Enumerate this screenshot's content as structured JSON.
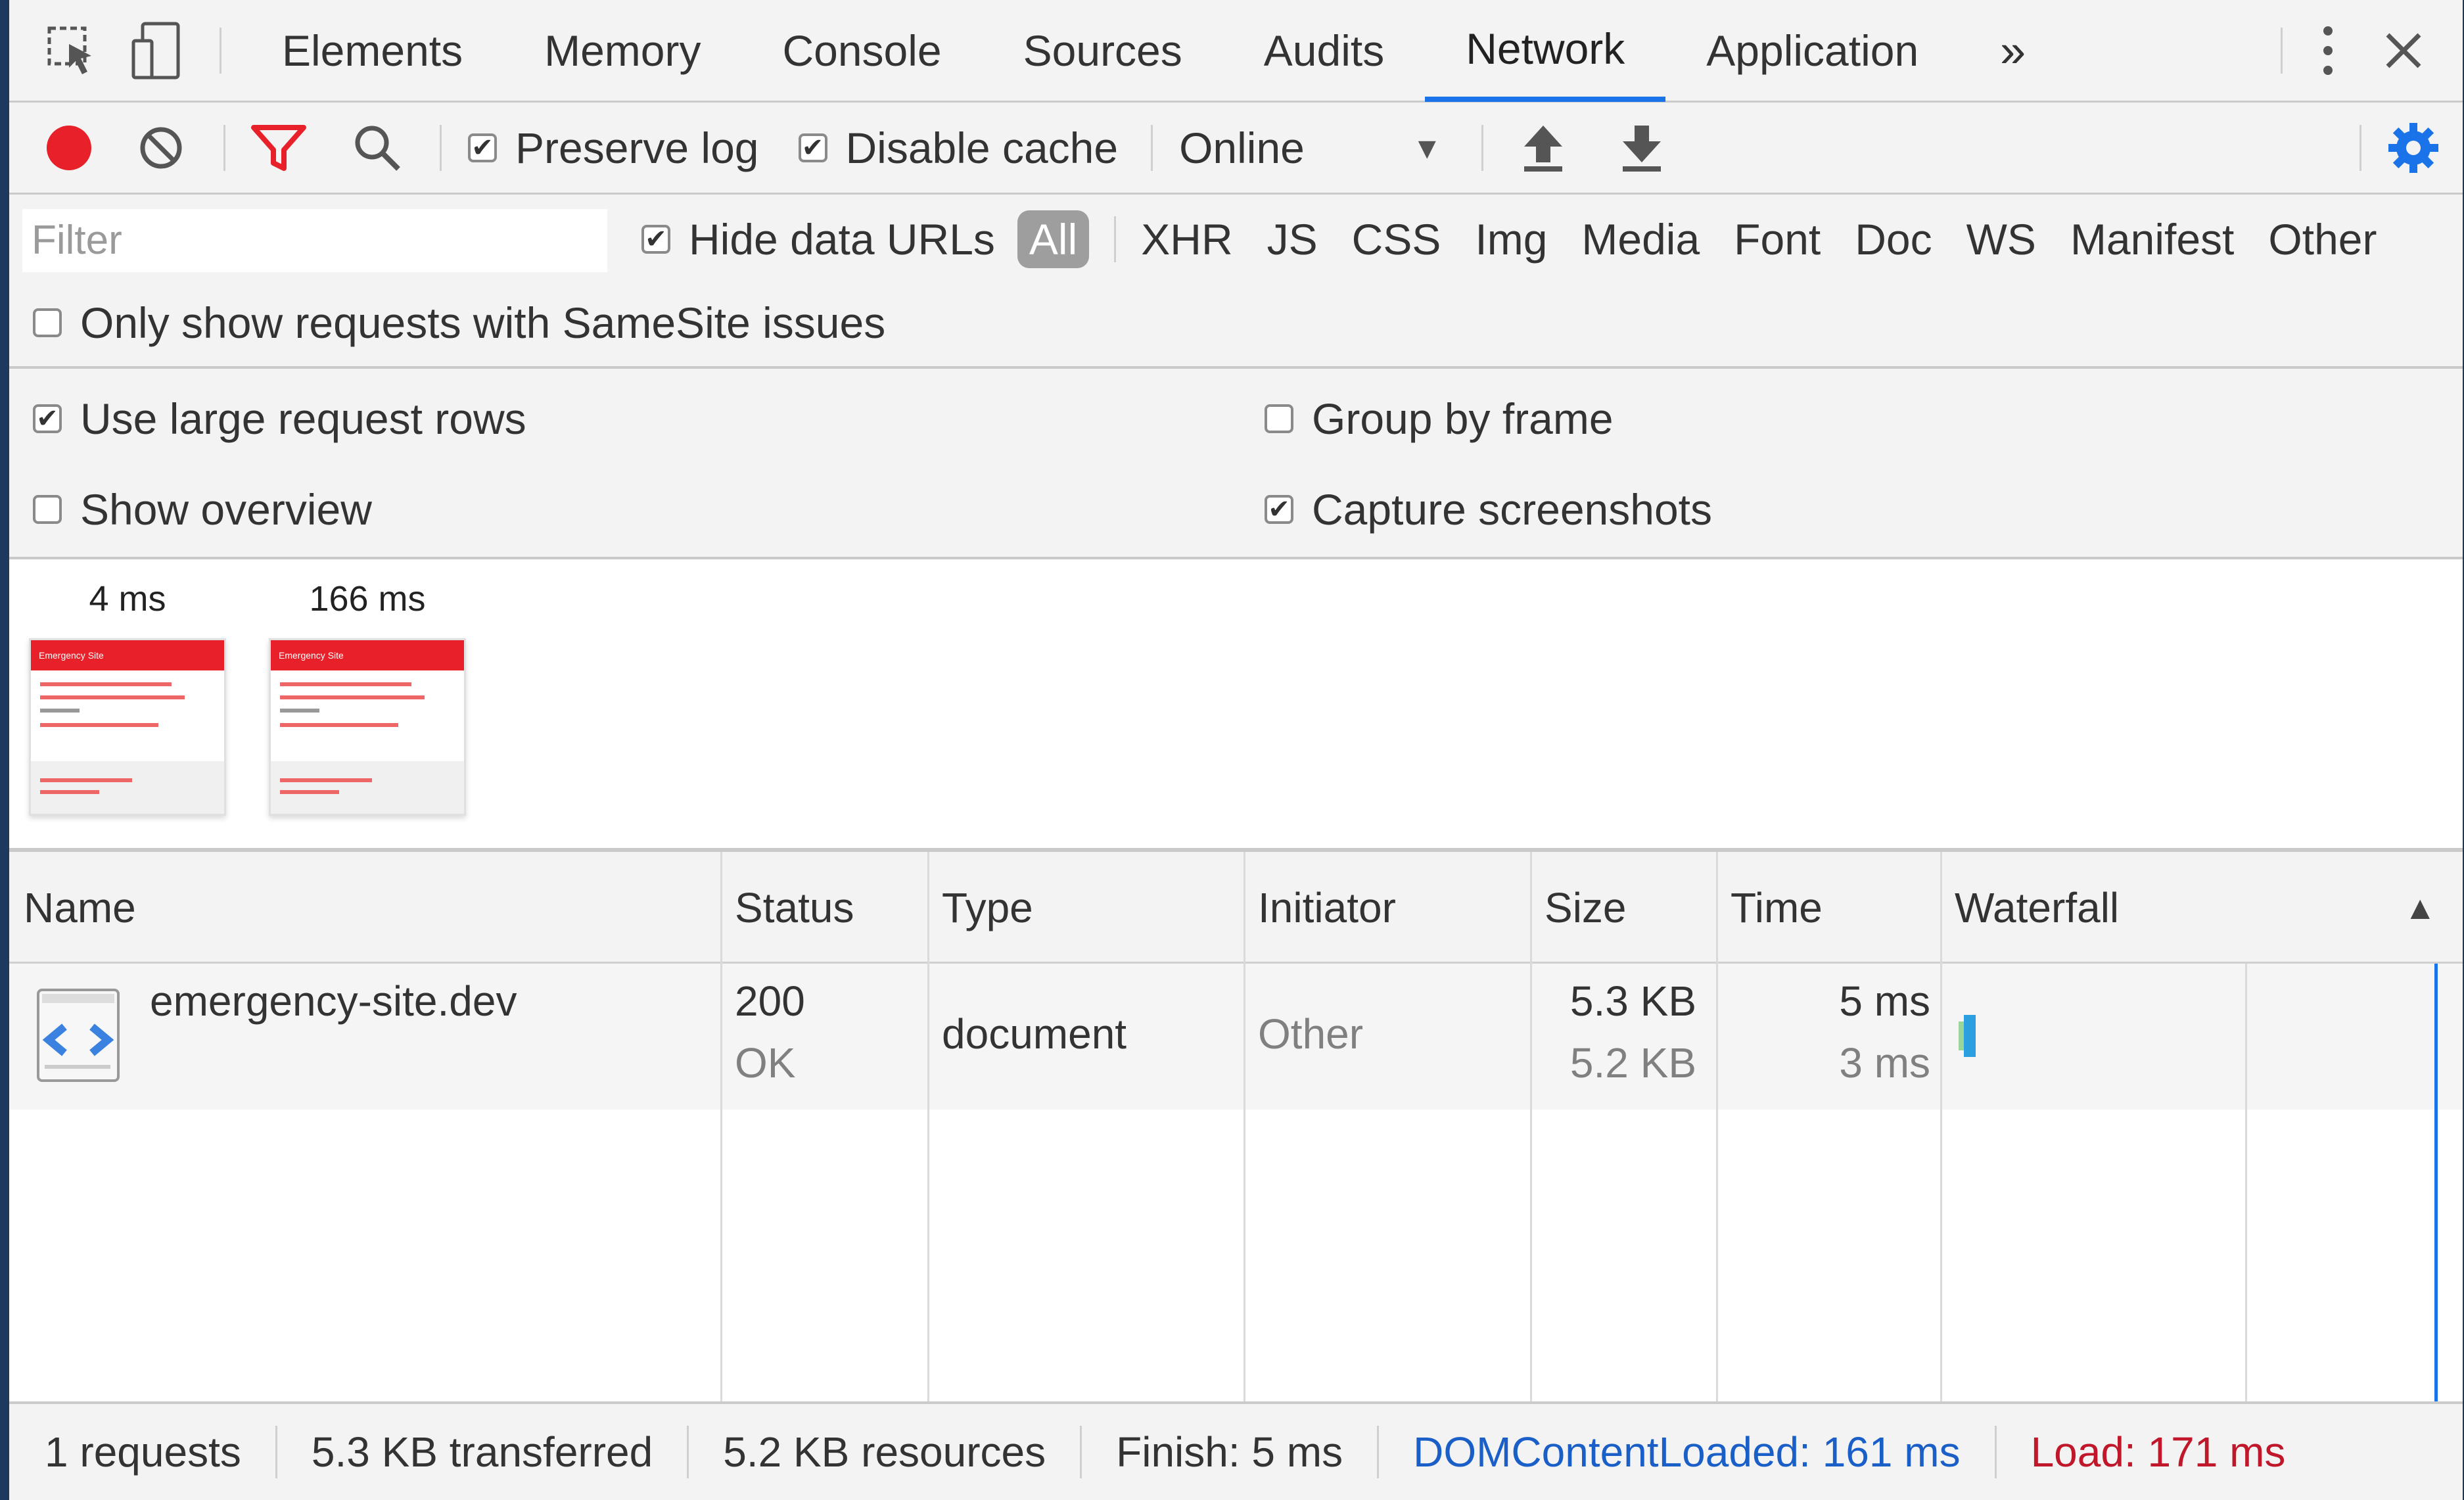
{
  "tabs": [
    "Elements",
    "Memory",
    "Console",
    "Sources",
    "Audits",
    "Network",
    "Application"
  ],
  "active_tab": "Network",
  "toolbar": {
    "preserve_log": "Preserve log",
    "disable_cache": "Disable cache",
    "throttling": "Online"
  },
  "filter": {
    "placeholder": "Filter",
    "hide_data_urls": "Hide data URLs",
    "types": [
      "All",
      "XHR",
      "JS",
      "CSS",
      "Img",
      "Media",
      "Font",
      "Doc",
      "WS",
      "Manifest",
      "Other"
    ],
    "samesite": "Only show requests with SameSite issues"
  },
  "settings": {
    "large_rows": "Use large request rows",
    "group_by_frame": "Group by frame",
    "show_overview": "Show overview",
    "capture_screenshots": "Capture screenshots"
  },
  "screenshots": [
    {
      "time": "4 ms",
      "thumb_title": "Emergency Site"
    },
    {
      "time": "166 ms",
      "thumb_title": "Emergency Site"
    }
  ],
  "columns": [
    "Name",
    "Status",
    "Type",
    "Initiator",
    "Size",
    "Time",
    "Waterfall"
  ],
  "requests": [
    {
      "name": "emergency-site.dev",
      "status": "200",
      "status_text": "OK",
      "type": "document",
      "initiator": "Other",
      "size": "5.3 KB",
      "size_resource": "5.2 KB",
      "time": "5 ms",
      "latency": "3 ms"
    }
  ],
  "status": {
    "requests": "1 requests",
    "transferred": "5.3 KB transferred",
    "resources": "5.2 KB resources",
    "finish": "Finish: 5 ms",
    "dcl": "DOMContentLoaded: 161 ms",
    "load": "Load: 171 ms"
  },
  "colors": {
    "record": "#e8202a",
    "active_tab_underline": "#1a73e8",
    "dcl": "#1a5fc8",
    "load": "#c0182a"
  },
  "icons": [
    "inspect-icon",
    "device-toolbar-icon",
    "more-tabs-icon",
    "kebab-menu-icon",
    "close-icon",
    "record-icon",
    "clear-icon",
    "filter-icon",
    "search-icon",
    "dropdown-arrow-icon",
    "upload-icon",
    "download-icon",
    "settings-gear-icon",
    "document-file-icon",
    "sort-asc-icon"
  ]
}
